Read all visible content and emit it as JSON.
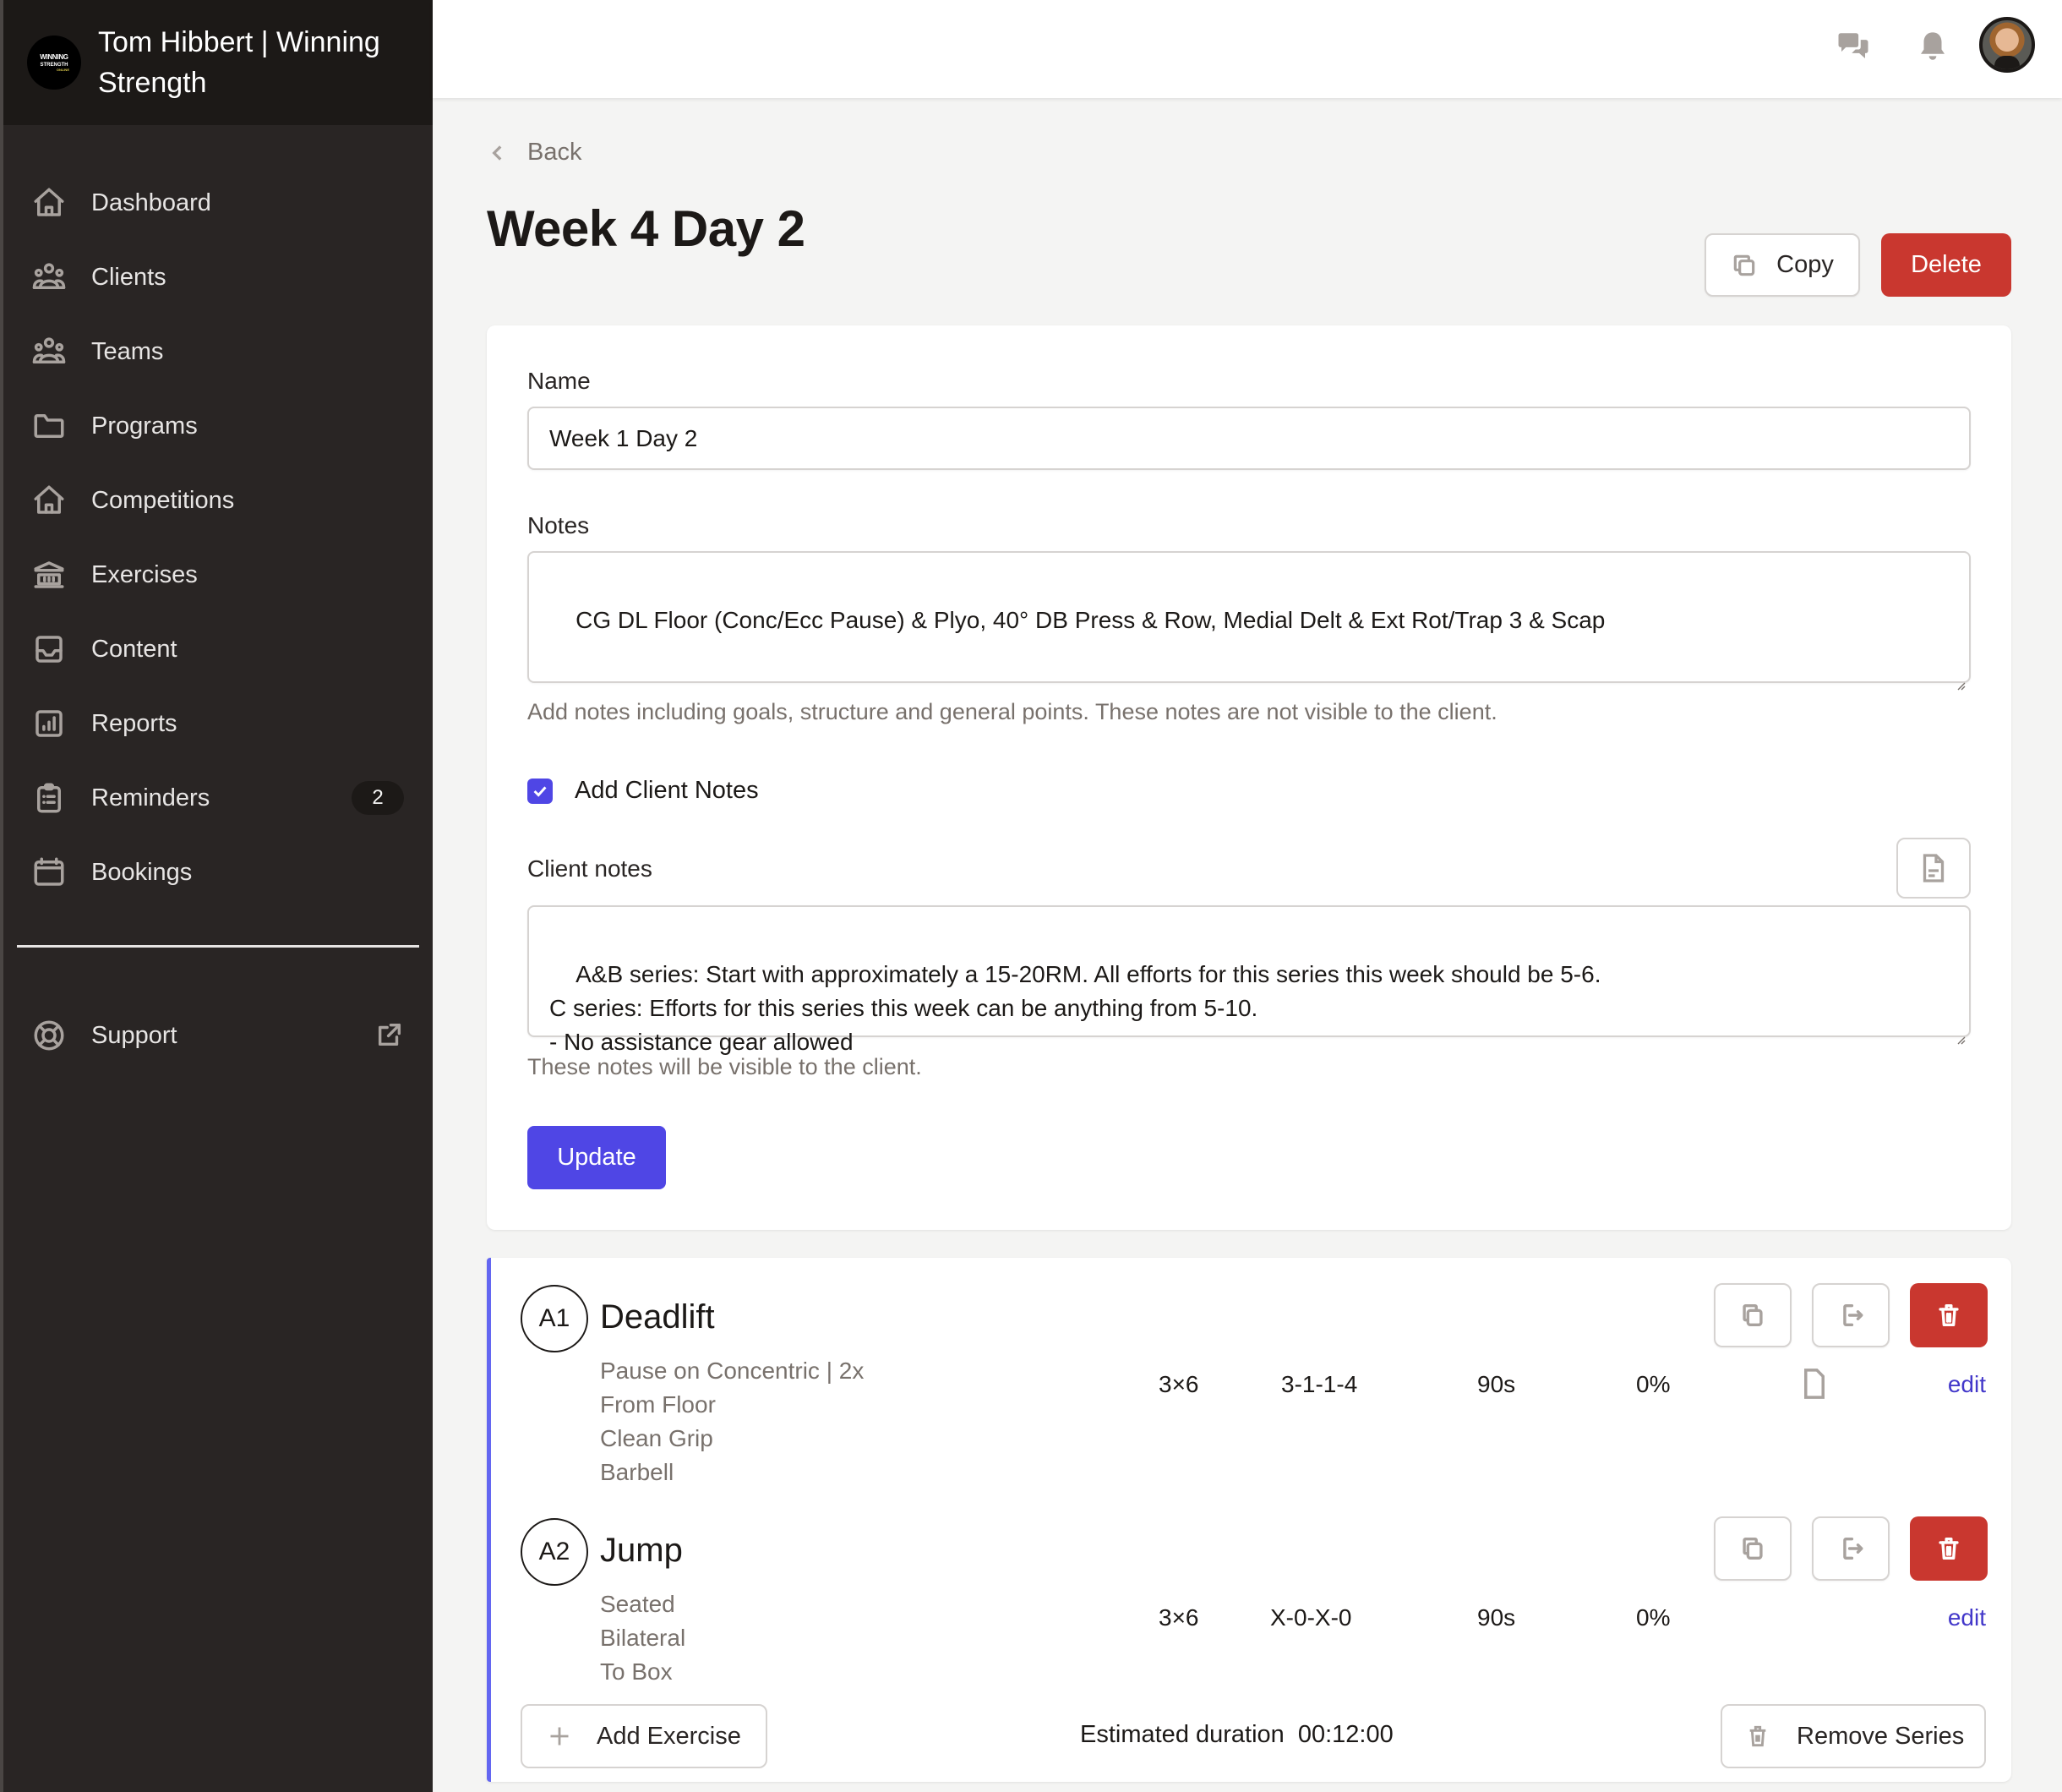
{
  "brand": {
    "name": "Tom Hibbert | Winning Strength",
    "logo_lines": [
      "WINNING",
      "STRENGTH",
      "ONLINE"
    ]
  },
  "sidebar": {
    "items": [
      {
        "label": "Dashboard",
        "icon": "home-icon"
      },
      {
        "label": "Clients",
        "icon": "users-icon"
      },
      {
        "label": "Teams",
        "icon": "users-icon"
      },
      {
        "label": "Programs",
        "icon": "folder-icon"
      },
      {
        "label": "Competitions",
        "icon": "home-icon"
      },
      {
        "label": "Exercises",
        "icon": "library-icon"
      },
      {
        "label": "Content",
        "icon": "inbox-icon"
      },
      {
        "label": "Reports",
        "icon": "chart-icon"
      },
      {
        "label": "Reminders",
        "icon": "clipboard-icon",
        "badge": "2"
      },
      {
        "label": "Bookings",
        "icon": "calendar-icon"
      }
    ],
    "support": {
      "label": "Support",
      "icon": "lifebuoy-icon",
      "trailing_icon": "external-link-icon"
    }
  },
  "header": {
    "icons": [
      "chat-icon",
      "bell-icon",
      "avatar"
    ]
  },
  "page": {
    "back_label": "Back",
    "title": "Week 4 Day 2",
    "copy_label": "Copy",
    "delete_label": "Delete"
  },
  "form": {
    "name_label": "Name",
    "name_value": "Week 1 Day 2",
    "notes_label": "Notes",
    "notes_value": "CG DL Floor (Conc/Ecc Pause) & Plyo, 40° DB Press & Row, Medial Delt & Ext Rot/Trap 3 & Scap",
    "notes_help": "Add notes including goals, structure and general points. These notes are not visible to the client.",
    "add_client_notes_label": "Add Client Notes",
    "add_client_notes_checked": true,
    "client_notes_label": "Client notes",
    "client_notes_value": "A&B series: Start with approximately a 15-20RM. All efforts for this series this week should be 5-6.\nC series: Efforts for this series this week can be anything from 5-10.\n- No assistance gear allowed",
    "client_notes_help": "These notes will be visible to the client.",
    "update_label": "Update"
  },
  "series": {
    "exercises": [
      {
        "code": "A1",
        "name": "Deadlift",
        "attributes": [
          "Pause on Concentric | 2x",
          "From Floor",
          "Clean Grip",
          "Barbell"
        ],
        "sets_reps": "3×6",
        "tempo": "3-1-1-4",
        "rest": "90s",
        "intensity": "0%",
        "has_note": true,
        "edit_label": "edit"
      },
      {
        "code": "A2",
        "name": "Jump",
        "attributes": [
          "Seated",
          "Bilateral",
          "To Box"
        ],
        "sets_reps": "3×6",
        "tempo": "X-0-X-0",
        "rest": "90s",
        "intensity": "0%",
        "has_note": false,
        "edit_label": "edit"
      }
    ],
    "add_exercise_label": "Add Exercise",
    "duration_label": "Estimated duration",
    "duration_value": "00:12:00",
    "remove_series_label": "Remove Series"
  },
  "colors": {
    "primary": "#4f46e5",
    "danger": "#c9372f",
    "sidebar_bg": "#292524",
    "series_accent": "#6366f1"
  }
}
